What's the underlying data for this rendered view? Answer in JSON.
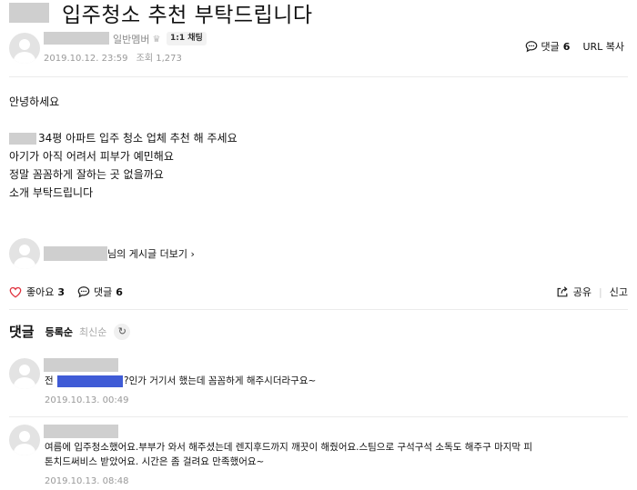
{
  "post": {
    "title": "입주청소 추천 부탁드립니다",
    "member_grade": "일반멤버",
    "chat_badge": "1:1 채팅",
    "date": "2019.10.12. 23:59",
    "views": "조회 1,273",
    "comment_label": "댓글",
    "comment_count": "6",
    "url_copy": "URL 복사",
    "body": {
      "line1": "안녕하세요",
      "line2": "34평 아파트 입주 청소 업체 추천 해 주세요",
      "line3": "아기가 아직 어려서 피부가 예민해요",
      "line4": "정말 꼼꼼하게 잘하는 곳 없을까요",
      "line5": "소개 부탁드립니다"
    },
    "more_posts": "님의 게시글 더보기 ›"
  },
  "reactions": {
    "like_label": "좋아요",
    "like_count": "3",
    "comment_label": "댓글",
    "comment_count": "6",
    "share_label": "공유",
    "separator": "|",
    "report_label": "신고"
  },
  "comments_section": {
    "title": "댓글",
    "sort_registered": "등록순",
    "sort_latest": "최신순",
    "refresh_icon": "refresh-icon",
    "items": [
      {
        "text_before": "전",
        "text_after": "?인가 거기서 했는데 꼼꼼하게 해주시더라구요~",
        "date": "2019.10.13. 00:49"
      },
      {
        "text_line1": "여름에 입주청소했어요.부부가 와서 해주셨는데 렌지후드까지 깨끗이 해줬어요.스팀으로 구석구석 소독도 해주구 마지막 피",
        "text_line2": "톤치드써비스 받았어요. 시간은 좀 걸려요 만족했어요~",
        "date": "2019.10.13. 08:48"
      }
    ]
  },
  "colors": {
    "like_heart": "#e0333f",
    "redaction_gray": "#cfcfcf",
    "redaction_blue": "#3f5bd6",
    "meta_gray": "#999999"
  }
}
